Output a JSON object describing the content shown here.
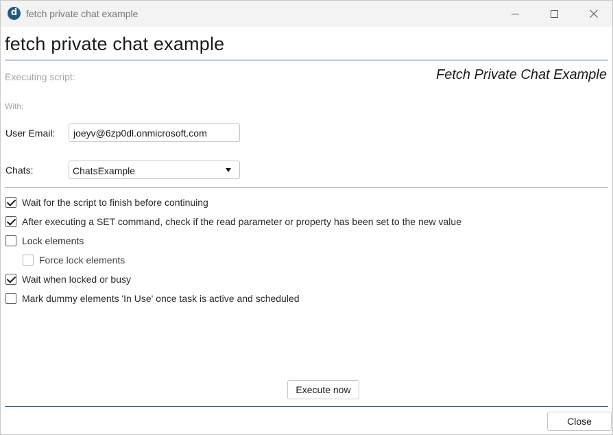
{
  "window": {
    "title": "fetch private chat example",
    "app_icon_letter": "d"
  },
  "header": {
    "title": "fetch private chat example",
    "executing_label": "Executing script:",
    "script_name": "Fetch Private Chat Example",
    "with_label": "With:"
  },
  "params": {
    "email_label": "User Email:",
    "email_value": "joeyv@6zp0dl.onmicrosoft.com",
    "chats_label": "Chats:",
    "chats_value": "ChatsExample"
  },
  "options": [
    {
      "label": "Wait for the script to finish before continuing",
      "checked": true
    },
    {
      "label": "After executing a SET command, check if the read parameter or property has been set to the new value",
      "checked": true
    },
    {
      "label": "Lock elements",
      "checked": false
    },
    {
      "label": "Force lock elements",
      "checked": false,
      "disabled": true
    },
    {
      "label": "Wait when locked or busy",
      "checked": true
    },
    {
      "label": "Mark dummy elements 'In Use' once task is active and scheduled",
      "checked": false
    }
  ],
  "buttons": {
    "execute": "Execute now",
    "close": "Close"
  }
}
